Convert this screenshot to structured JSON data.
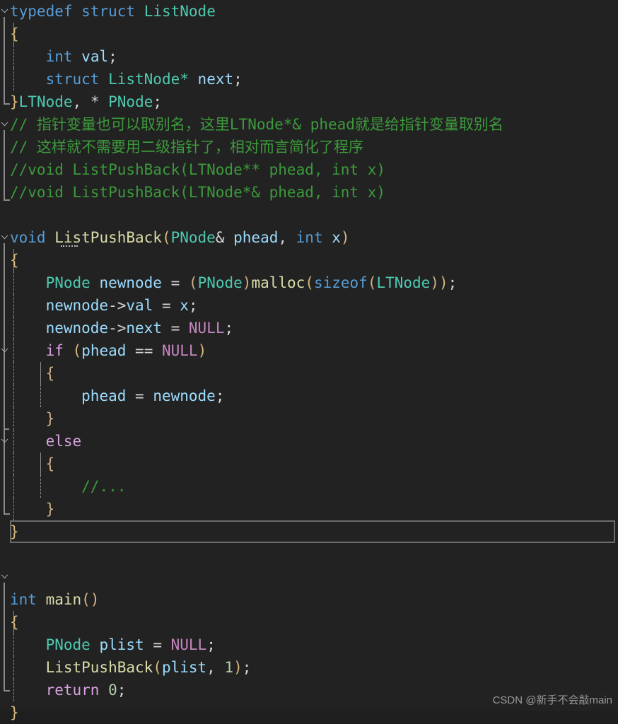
{
  "editor": {
    "theme": "dark",
    "background": "#222222",
    "language": "C",
    "colors": {
      "keyword": "#569cd6",
      "control_keyword": "#d8a0df",
      "type": "#4ec9b0",
      "function": "#dcdcaa",
      "variable": "#9cdcfe",
      "macro": "#c586c0",
      "number": "#b5cea8",
      "comment": "#3c9a3c",
      "punctuation": "#d4d4d4",
      "current_line_border": "#6b6b6b",
      "indent_guide": "#8d8d8d",
      "fold_marker": "#8a8a8a"
    }
  },
  "lines": {
    "l1": {
      "kw": "typedef",
      "kw2": "struct",
      "type": "ListNode"
    },
    "l2": {
      "brace": "{"
    },
    "l3": {
      "kw": "int",
      "var": "val",
      "semi": ";"
    },
    "l4": {
      "kw": "struct",
      "type": "ListNode*",
      "var": "next",
      "semi": ";"
    },
    "l5": {
      "brace": "}",
      "type": "LTNode",
      "comma": ",",
      "star": "*",
      "type2": "PNode",
      "semi": ";"
    },
    "l6": {
      "comment": "// 指针变量也可以取别名，这里LTNode*& phead就是给指针变量取别名"
    },
    "l7": {
      "comment": "// 这样就不需要用二级指针了，相对而言简化了程序"
    },
    "l8": {
      "comment": "//void ListPushBack(LTNode** phead, int x)"
    },
    "l9": {
      "comment": "//void ListPushBack(LTNode*& phead, int x)"
    },
    "l10": {
      "blank": ""
    },
    "l11": {
      "kw": "void",
      "fn": "ListPushBack",
      "paren_open": "(",
      "type": "PNode",
      "amp": "&",
      "var": "phead",
      "comma": ", ",
      "kw2": "int",
      "var2": "x",
      "paren_close": ")"
    },
    "l12": {
      "brace": "{"
    },
    "l13": {
      "type": "PNode",
      "var": "newnode",
      "eq": " = ",
      "cast_open": "(",
      "type2": "PNode",
      "cast_close": ")",
      "fn": "malloc",
      "p1": "(",
      "kw": "sizeof",
      "p2": "(",
      "type3": "LTNode",
      "p3": ")",
      "p4": ")",
      "semi": ";"
    },
    "l14": {
      "var": "newnode",
      "arrow": "->",
      "field": "val",
      "eq": " = ",
      "var2": "x",
      "semi": ";"
    },
    "l15": {
      "var": "newnode",
      "arrow": "->",
      "field": "next",
      "eq": " = ",
      "macro": "NULL",
      "semi": ";"
    },
    "l16": {
      "ctl": "if",
      "space": " ",
      "paren_open": "(",
      "var": "phead",
      "op": " == ",
      "macro": "NULL",
      "paren_close": ")"
    },
    "l17": {
      "brace": "{"
    },
    "l18": {
      "var": "phead",
      "eq": " = ",
      "var2": "newnode",
      "semi": ";"
    },
    "l19": {
      "brace": "}"
    },
    "l20": {
      "ctl": "else"
    },
    "l21": {
      "brace": "{"
    },
    "l22": {
      "comment": "//..."
    },
    "l23": {
      "brace": "}"
    },
    "l24": {
      "brace": "}",
      "current_line": true
    },
    "l25": {
      "blank": ""
    },
    "l26": {
      "blank": ""
    },
    "l27": {
      "kw": "int",
      "fn": "main",
      "parens": "()"
    },
    "l28": {
      "brace": "{"
    },
    "l29": {
      "type": "PNode",
      "var": "plist",
      "eq": " = ",
      "macro": "NULL",
      "semi": ";"
    },
    "l30": {
      "fn": "ListPushBack",
      "paren_open": "(",
      "var": "plist",
      "comma": ", ",
      "num": "1",
      "paren_close": ")",
      "semi": ";"
    },
    "l31": {
      "ctl": "return",
      "space": " ",
      "num": "0",
      "semi": ";"
    },
    "l32": {
      "brace": "}"
    }
  },
  "watermark": {
    "text": "CSDN @新手不会敲main"
  }
}
